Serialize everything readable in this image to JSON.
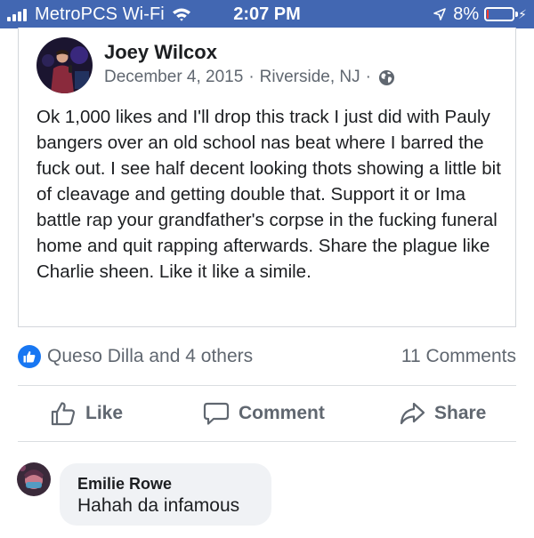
{
  "status_bar": {
    "carrier": "MetroPCS Wi-Fi",
    "time": "2:07 PM",
    "battery_percent": "8%",
    "battery_level": 0.08,
    "accent": "#4267b2",
    "battery_color": "#ff3b30"
  },
  "post": {
    "author": "Joey Wilcox",
    "date": "December 4, 2015",
    "location": "Riverside, NJ",
    "separator": "·",
    "privacy_icon": "globe-icon",
    "text": "Ok 1,000 likes and I'll drop this track I just did with Pauly bangers over an old school nas beat where I barred the fuck out. I see half decent looking thots showing a little bit of cleavage and getting double that. Support it or Ima battle rap your grandfather's corpse in the fucking funeral home and quit rapping afterwards. Share the plague like Charlie sheen. Like it like a simile."
  },
  "reactions": {
    "summary": "Queso Dilla and 4 others",
    "comments_count": "11 Comments",
    "like_color": "#1877f2"
  },
  "actions": {
    "like": "Like",
    "comment": "Comment",
    "share": "Share"
  },
  "comments": [
    {
      "name": "Emilie Rowe",
      "text": "Hahah da infamous"
    }
  ]
}
